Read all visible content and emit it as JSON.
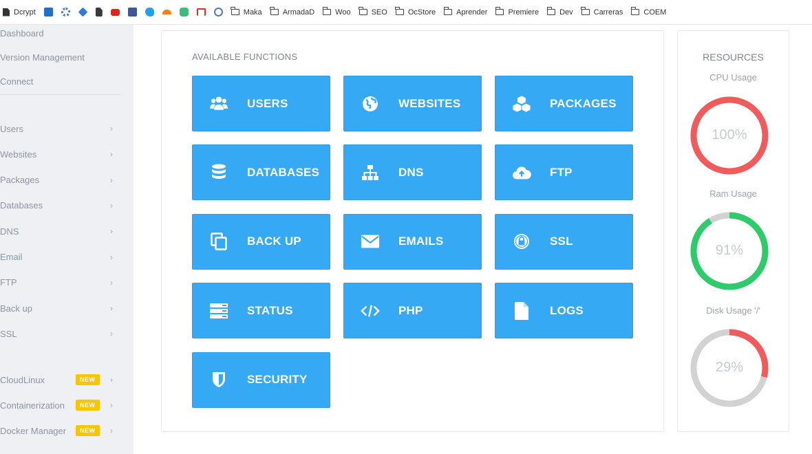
{
  "bookmarks": [
    {
      "label": "Dcrypt",
      "color": "#3a3a3a"
    },
    {
      "label": "",
      "color": "#1e6fce"
    },
    {
      "label": "",
      "color": "#3b74d6"
    },
    {
      "label": "",
      "color": "#2f7bde"
    },
    {
      "label": "",
      "color": "#3a3a3a"
    },
    {
      "label": "",
      "color": "#e62117"
    },
    {
      "label": "",
      "color": "#3b5998"
    },
    {
      "label": "",
      "color": "#1da1f2"
    },
    {
      "label": "",
      "color": "#f38020"
    },
    {
      "label": "",
      "color": "#35c07a"
    },
    {
      "label": "",
      "color": "#d93025"
    },
    {
      "label": "",
      "color": "#4a79c9"
    }
  ],
  "folders": [
    "Maka",
    "ArmadaD",
    "Woo",
    "SEO",
    "OcStore",
    "Aprender",
    "Premiere",
    "Dev",
    "Carreras",
    "COEM"
  ],
  "sidebar": {
    "top_items": [
      "Dashboard",
      "Version Management",
      "Connect"
    ],
    "menu_items": [
      "Users",
      "Websites",
      "Packages",
      "Databases",
      "DNS",
      "Email",
      "FTP",
      "Back up",
      "SSL"
    ],
    "new_items": [
      "CloudLinux",
      "Containerization",
      "Docker Manager"
    ],
    "chevron": "›",
    "badge": "NEW"
  },
  "main": {
    "title": "AVAILABLE FUNCTIONS",
    "functions": [
      {
        "label": "USERS",
        "icon": "users-icon"
      },
      {
        "label": "WEBSITES",
        "icon": "globe-icon"
      },
      {
        "label": "PACKAGES",
        "icon": "cubes-icon"
      },
      {
        "label": "DATABASES",
        "icon": "database-icon"
      },
      {
        "label": "DNS",
        "icon": "sitemap-icon"
      },
      {
        "label": "FTP",
        "icon": "cloud-upload-icon"
      },
      {
        "label": "BACK UP",
        "icon": "copy-icon"
      },
      {
        "label": "EMAILS",
        "icon": "envelope-icon"
      },
      {
        "label": "SSL",
        "icon": "lock-icon"
      },
      {
        "label": "STATUS",
        "icon": "server-icon"
      },
      {
        "label": "PHP",
        "icon": "code-icon"
      },
      {
        "label": "LOGS",
        "icon": "file-icon"
      },
      {
        "label": "SECURITY",
        "icon": "shield-icon"
      }
    ]
  },
  "resources": {
    "title": "RESOURCES",
    "gauges": [
      {
        "label": "CPU Usage",
        "value": 100,
        "text": "100%",
        "color": "#f25b5b"
      },
      {
        "label": "Ram Usage",
        "value": 91,
        "text": "91%",
        "color": "#2dcb6a"
      },
      {
        "label": "Disk Usage '/'",
        "value": 29,
        "text": "29%",
        "color": "#f25b5b"
      }
    ]
  }
}
